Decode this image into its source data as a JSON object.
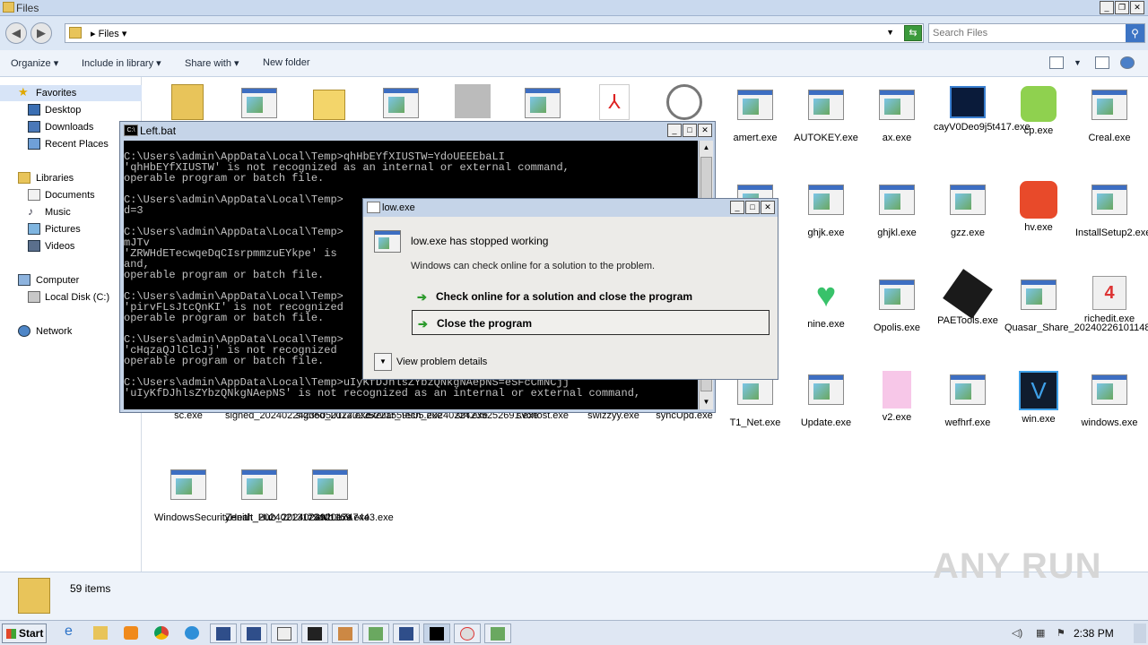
{
  "explorer": {
    "title": "Files",
    "address": "Files",
    "search_placeholder": "Search Files",
    "toolbar": {
      "organize": "Organize",
      "include": "Include in library",
      "share": "Share with",
      "new_folder": "New folder"
    },
    "status": "59 items"
  },
  "sidebar": {
    "favorites": "Favorites",
    "desktop": "Desktop",
    "downloads": "Downloads",
    "recent": "Recent Places",
    "libraries": "Libraries",
    "documents": "Documents",
    "music": "Music",
    "pictures": "Pictures",
    "videos": "Videos",
    "computer": "Computer",
    "local_disk": "Local Disk (C:)",
    "network": "Network"
  },
  "files": {
    "r1": [
      "amert.exe",
      "AUTOKEY.exe",
      "ax.exe",
      "cayV0Deo9j5t417.exe",
      "cp.exe",
      "Creal.exe"
    ],
    "r2": [
      "ghjk.exe",
      "ghjkl.exe",
      "gzz.exe",
      "hv.exe",
      "InstallSetup2.exe"
    ],
    "r3": [
      "nine.exe",
      "Opolis.exe",
      "PAETools.exe",
      "Quasar_Share_20240226101148498.exe",
      "richedit.exe"
    ],
    "r4": [
      "sc.exe",
      "signed_20240224235050112.exe",
      "signed_20240225221559905.exe",
      "Stellar_Tech_20240224235252691.exe",
      "strt.exe",
      "svchost.exe",
      "swizzyy.exe",
      "syncUpd.exe",
      "T1_Net.exe",
      "Update.exe",
      "v2.exe",
      "wefhrf.exe",
      "win.exe",
      "windows.exe"
    ],
    "r5": [
      "WindowsSecurityHealt_20240213173401169.exe",
      "Zenith_Hub_20240229201747443.exe",
      "zxcvb.exe"
    ]
  },
  "cmd": {
    "title": "Left.bat",
    "lines": "C:\\Users\\admin\\AppData\\Local\\Temp>qhHbEYfXIUSTW=YdoUEEEbaLI\n'qhHbEYfXIUSTW' is not recognized as an internal or external command,\noperable program or batch file.\n\nC:\\Users\\admin\\AppData\\Local\\Temp>\nd=3\n\nC:\\Users\\admin\\AppData\\Local\\Temp>\nmJTv\n'ZRWHdETecwqeDqCIsrpmmzuEYkpe' is\nand,\noperable program or batch file.\n\nC:\\Users\\admin\\AppData\\Local\\Temp>\n'pirvFLsJtcQnKI' is not recognized\noperable program or batch file.\n\nC:\\Users\\admin\\AppData\\Local\\Temp>\n'cHqzaQJlClcJj' is not recognized\noperable program or batch file.\n\nC:\\Users\\admin\\AppData\\Local\\Temp>uIyKfDJhlsZYbzQNkgNAepNS=eSFcCmNCjj\n'uIyKfDJhlsZYbzQNkgNAepNS' is not recognized as an internal or external command,"
  },
  "dialog": {
    "title": "low.exe",
    "heading": "low.exe has stopped working",
    "sub": "Windows can check online for a solution to the problem.",
    "opt1": "Check online for a solution and close the program",
    "opt2": "Close the program",
    "details": "View problem details"
  },
  "taskbar": {
    "start": "Start",
    "clock": "2:38 PM"
  },
  "watermark": "ANY RUN"
}
